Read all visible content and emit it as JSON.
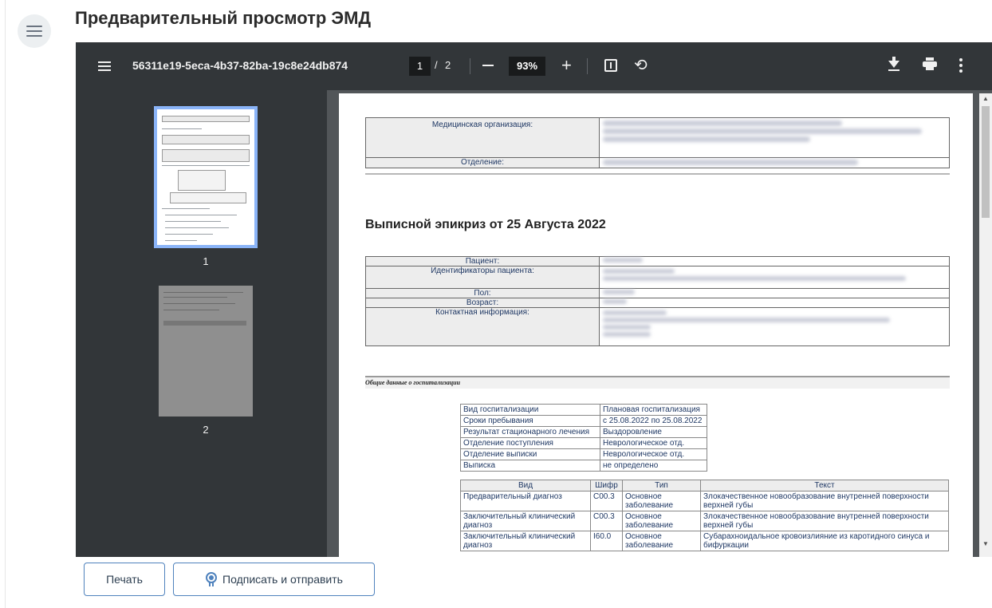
{
  "page": {
    "title": "Предварительный просмотр ЭМД"
  },
  "viewer": {
    "document_name": "56311e19-5eca-4b37-82ba-19c8e24db874",
    "current_page": "1",
    "page_separator": "/",
    "total_pages": "2",
    "zoom": "93%",
    "thumbnails": [
      "1",
      "2"
    ]
  },
  "document": {
    "org_label": "Медицинская организация:",
    "dept_label": "Отделение:",
    "title": "Выписной эпикриз от 25 Августа 2022",
    "patient_labels": {
      "patient": "Пациент:",
      "ids": "Идентификаторы пациента:",
      "sex": "Пол:",
      "age": "Возраст:",
      "contact": "Контактная информация:"
    },
    "section_title": "Общие данные о госпитализации",
    "hospitalization": [
      {
        "label": "Вид госпитализации",
        "value": "Плановая госпитализация"
      },
      {
        "label": "Сроки пребывания",
        "value": "с 25.08.2022 по 25.08.2022"
      },
      {
        "label": "Результат стационарного лечения",
        "value": "Выздоровление"
      },
      {
        "label": "Отделение поступления",
        "value": "Неврологическое отд."
      },
      {
        "label": "Отделение выписки",
        "value": "Неврологическое отд."
      },
      {
        "label": "Выписка",
        "value": "не определено"
      }
    ],
    "diagnosis_headers": [
      "Вид",
      "Шифр",
      "Тип",
      "Текст"
    ],
    "diagnoses": [
      {
        "kind": "Предварительный диагноз",
        "code": "C00.3",
        "type": "Основное заболевание",
        "text": "Злокачественное новообразование внутренней поверхности верхней губы"
      },
      {
        "kind": "Заключительный клинический диагноз",
        "code": "C00.3",
        "type": "Основное заболевание",
        "text": "Злокачественное новообразование внутренней поверхности верхней губы"
      },
      {
        "kind": "Заключительный клинический диагноз",
        "code": "I60.0",
        "type": "Основное заболевание",
        "text": "Субарахноидальное кровоизлияние из каротидного синуса и бифуркации"
      }
    ]
  },
  "actions": {
    "print": "Печать",
    "sign_and_send": "Подписать и отправить"
  },
  "icons": [
    "menu-icon",
    "pdf-menu-icon",
    "zoom-out-icon",
    "zoom-in-icon",
    "fit-page-icon",
    "rotate-icon",
    "download-icon",
    "print-icon",
    "more-icon",
    "signature-icon"
  ]
}
